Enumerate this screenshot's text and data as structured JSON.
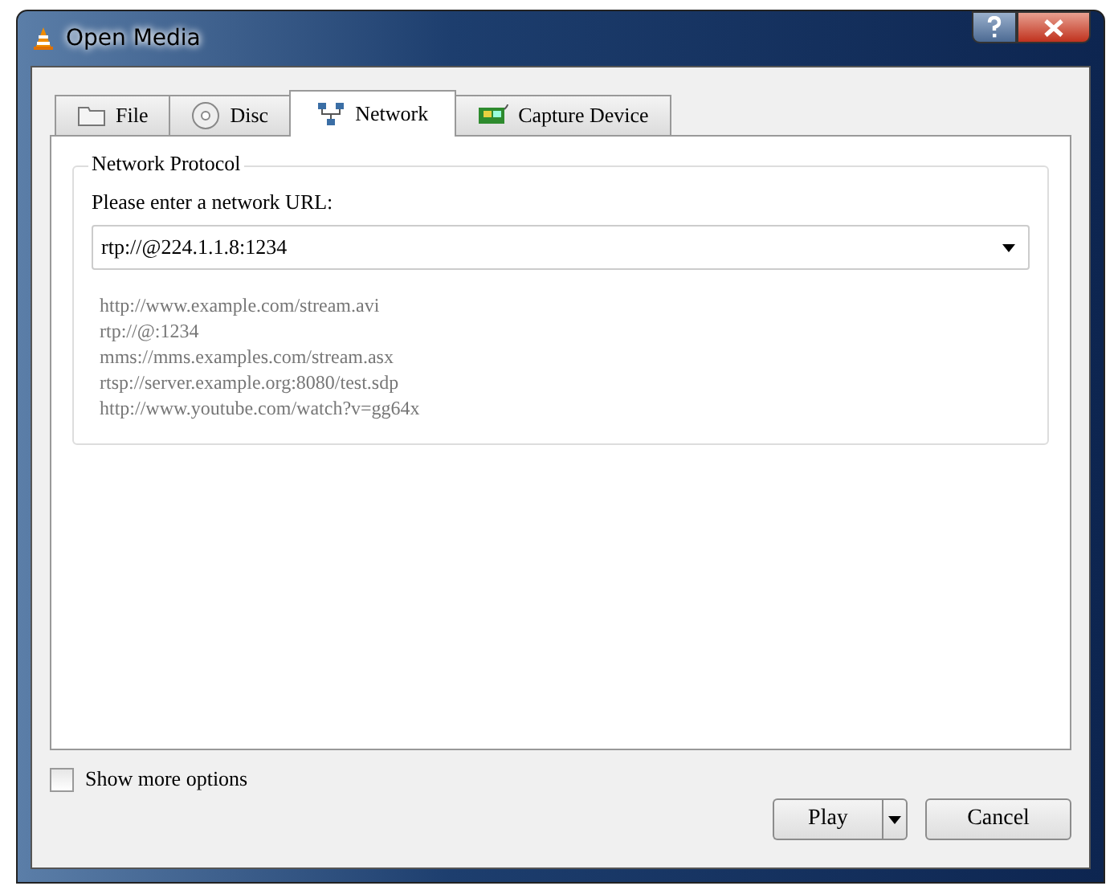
{
  "window": {
    "title": "Open Media"
  },
  "tabs": [
    {
      "label": "File",
      "kind": "folder",
      "selected": false
    },
    {
      "label": "Disc",
      "kind": "disc",
      "selected": false
    },
    {
      "label": "Network",
      "kind": "network",
      "selected": true
    },
    {
      "label": "Capture Device",
      "kind": "card",
      "selected": false
    }
  ],
  "network_protocol": {
    "title": "Network Protocol",
    "prompt": "Please enter a network URL:",
    "url": "rtp://@224.1.1.8:1234",
    "examples": [
      "http://www.example.com/stream.avi",
      "rtp://@:1234",
      "mms://mms.examples.com/stream.asx",
      "rtsp://server.example.org:8080/test.sdp",
      "http://www.youtube.com/watch?v=gg64x"
    ]
  },
  "show_more_options": {
    "label": "Show more options",
    "checked": false
  },
  "buttons": [
    {
      "label": "Play",
      "kind": "split"
    },
    {
      "label": "Cancel",
      "kind": "plain"
    }
  ]
}
